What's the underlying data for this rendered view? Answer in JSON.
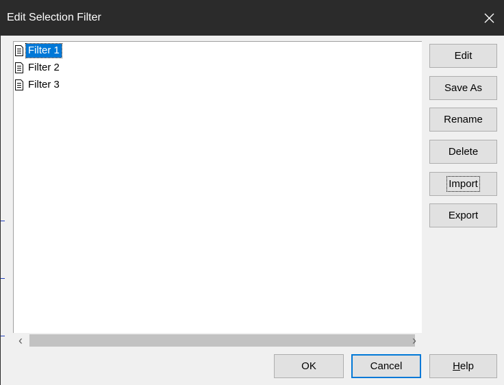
{
  "window": {
    "title": "Edit Selection Filter",
    "close_icon": "close-icon"
  },
  "filters": {
    "items": [
      {
        "label": "Filter 1",
        "icon": "document-icon",
        "selected": true
      },
      {
        "label": "Filter 2",
        "icon": "document-icon",
        "selected": false
      },
      {
        "label": "Filter 3",
        "icon": "document-icon",
        "selected": false
      }
    ]
  },
  "actions": {
    "edit": "Edit",
    "save_as": "Save As",
    "rename": "Rename",
    "delete": "Delete",
    "import": "Import",
    "export": "Export"
  },
  "footer": {
    "ok": "OK",
    "cancel": "Cancel",
    "help_mnemonic": "H",
    "help_rest": "elp"
  },
  "scrollbar": {
    "left_arrow": "‹",
    "right_arrow": "›"
  },
  "colors": {
    "titlebar": "#2b2b2b",
    "selection": "#0078d7",
    "dialog_bg": "#f0f0f0"
  }
}
